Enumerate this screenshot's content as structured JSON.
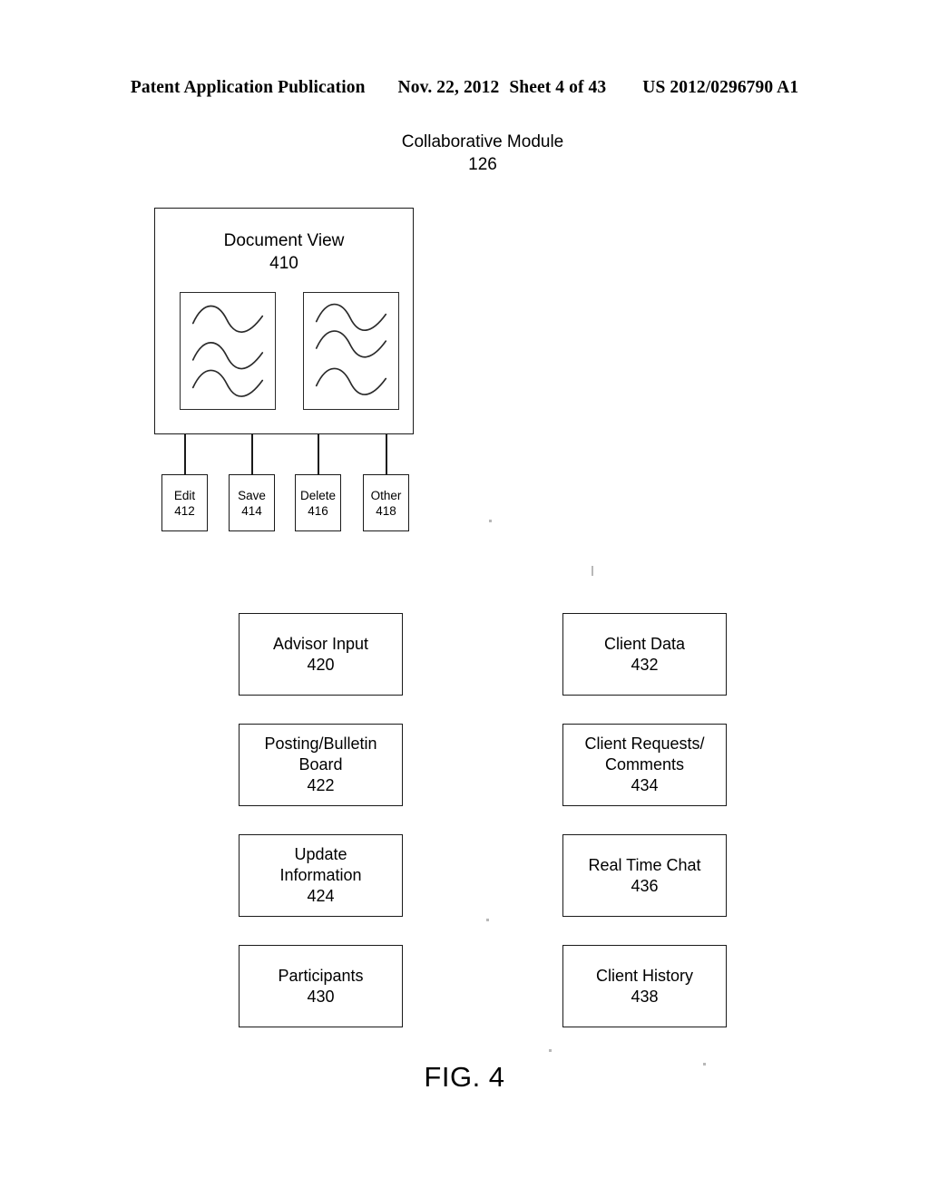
{
  "header": {
    "publication": "Patent Application Publication",
    "date": "Nov. 22, 2012",
    "sheet": "Sheet 4 of 43",
    "doc_number": "US 2012/0296790 A1"
  },
  "figure": {
    "title": "Collaborative Module",
    "title_ref": "126",
    "caption": "FIG. 4"
  },
  "document_view": {
    "label": "Document View",
    "ref": "410",
    "thumbnails": [
      {
        "name": "document-thumbnail-left",
        "squiggle_count": 3
      },
      {
        "name": "document-thumbnail-right",
        "squiggle_count": 3
      }
    ]
  },
  "actions": [
    {
      "label": "Edit",
      "ref": "412"
    },
    {
      "label": "Save",
      "ref": "414"
    },
    {
      "label": "Delete",
      "ref": "416"
    },
    {
      "label": "Other",
      "ref": "418"
    }
  ],
  "left_column": [
    {
      "label": "Advisor Input",
      "ref": "420"
    },
    {
      "label": "Posting/Bulletin\nBoard",
      "ref": "422"
    },
    {
      "label": "Update\nInformation",
      "ref": "424"
    },
    {
      "label": "Participants",
      "ref": "430"
    }
  ],
  "right_column": [
    {
      "label": "Client Data",
      "ref": "432"
    },
    {
      "label": "Client Requests/\nComments",
      "ref": "434"
    },
    {
      "label": "Real Time Chat",
      "ref": "436"
    },
    {
      "label": "Client History",
      "ref": "438"
    }
  ],
  "colors": {
    "ink": "#1a1a1a",
    "paper": "#ffffff"
  }
}
